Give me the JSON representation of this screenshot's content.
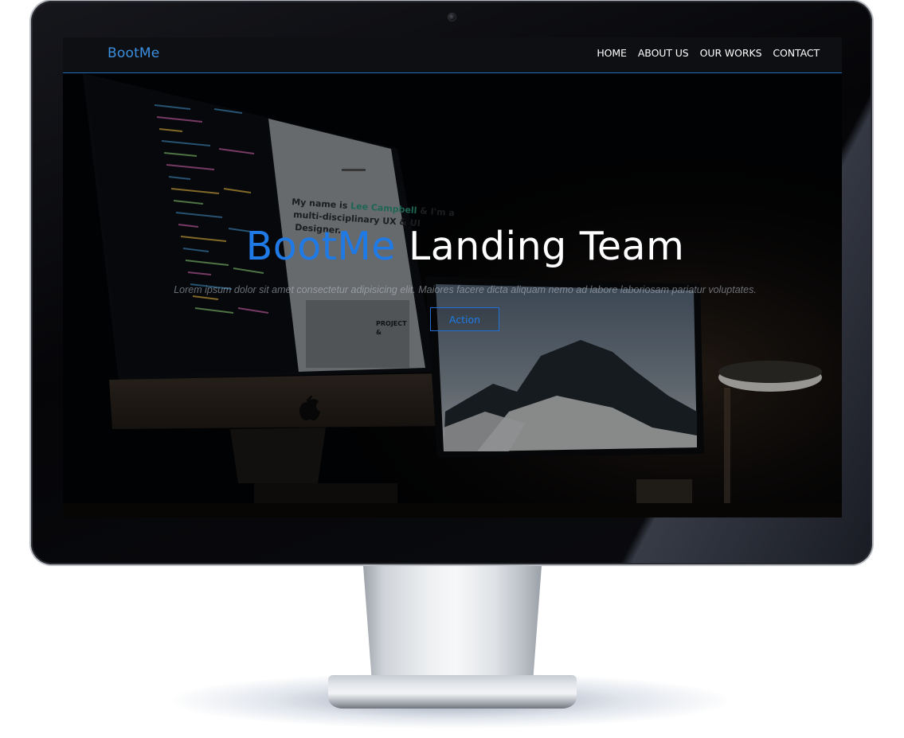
{
  "navbar": {
    "brand": "BootMe",
    "links": [
      "HOME",
      "ABOUT US",
      "OUR WORKS",
      "CONTACT"
    ]
  },
  "hero": {
    "title_accent": "BootMe",
    "title_rest": "Landing Team",
    "subtitle": "Lorem ipsum dolor sit amet consectetur adipisicing elit. Maiores facere dicta aliquam nemo ad labore laboriosam pariatur voluptates.",
    "action_label": "Action"
  },
  "background_photo": {
    "screen_heading": "My name is Lee Campbell & I'm a multi-disciplinary UX & UI Designer.",
    "screen_heading_name": "Lee Campbell",
    "card_label": "PROJECT &"
  },
  "colors": {
    "accent": "#1f7ae6",
    "nav_bg": "#0e0f12",
    "nav_border": "#1f6fbf",
    "text": "#ffffff",
    "name_highlight": "#35c6a2"
  },
  "icons": {
    "apple_logo": "apple-logo-icon"
  }
}
